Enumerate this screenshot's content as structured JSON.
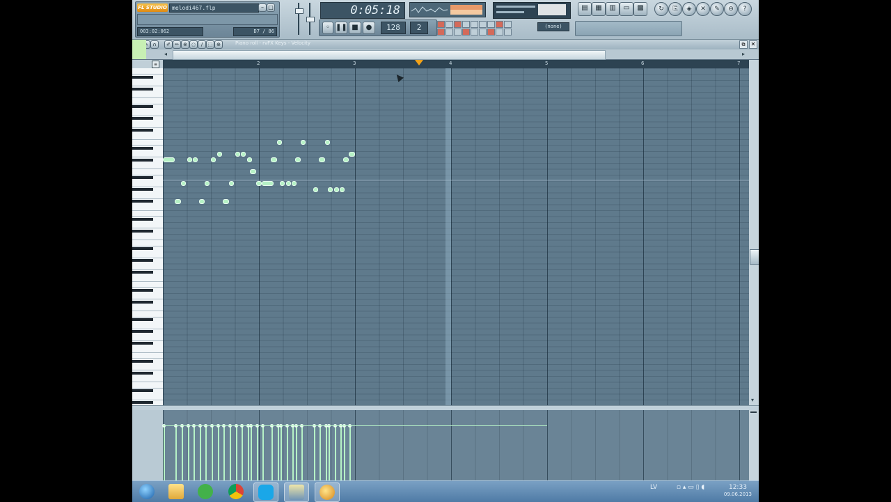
{
  "app": {
    "logo": "FL STUDIO",
    "project_file": "melodi467.flp",
    "position_readout": "003:02:062",
    "steps_readout": "D7 / 86",
    "time_display": "0:05:18",
    "tempo": "128",
    "snap_value": "(none)",
    "pattern_readout": "2"
  },
  "piano_roll": {
    "title": "Piano roll - rvFX Keys - Velocity",
    "bar_numbers": [
      "2",
      "3",
      "4",
      "5",
      "6",
      "7"
    ]
  },
  "notes": [
    {
      "start": 0.0,
      "len": 0.5,
      "row": 15
    },
    {
      "start": 0.5,
      "len": 0.25,
      "row": 22
    },
    {
      "start": 0.75,
      "len": 0.12,
      "row": 19
    },
    {
      "start": 1.0,
      "len": 0.12,
      "row": 15
    },
    {
      "start": 1.25,
      "len": 0.12,
      "row": 15
    },
    {
      "start": 1.5,
      "len": 0.25,
      "row": 22
    },
    {
      "start": 1.75,
      "len": 0.12,
      "row": 19
    },
    {
      "start": 2.0,
      "len": 0.12,
      "row": 15
    },
    {
      "start": 2.25,
      "len": 0.12,
      "row": 14
    },
    {
      "start": 2.5,
      "len": 0.25,
      "row": 22
    },
    {
      "start": 2.75,
      "len": 0.12,
      "row": 19
    },
    {
      "start": 3.0,
      "len": 0.12,
      "row": 14
    },
    {
      "start": 3.25,
      "len": 0.12,
      "row": 14
    },
    {
      "start": 3.5,
      "len": 0.12,
      "row": 15
    },
    {
      "start": 3.62,
      "len": 0.25,
      "row": 17
    },
    {
      "start": 3.87,
      "len": 0.25,
      "row": 19
    },
    {
      "start": 4.12,
      "len": 0.5,
      "row": 19
    },
    {
      "start": 4.5,
      "len": 0.25,
      "row": 15
    },
    {
      "start": 4.75,
      "len": 0.12,
      "row": 12
    },
    {
      "start": 4.87,
      "len": 0.12,
      "row": 19
    },
    {
      "start": 5.12,
      "len": 0.12,
      "row": 19
    },
    {
      "start": 5.37,
      "len": 0.12,
      "row": 19
    },
    {
      "start": 5.5,
      "len": 0.25,
      "row": 15
    },
    {
      "start": 5.75,
      "len": 0.12,
      "row": 12
    },
    {
      "start": 6.25,
      "len": 0.12,
      "row": 20
    },
    {
      "start": 6.5,
      "len": 0.25,
      "row": 15
    },
    {
      "start": 6.75,
      "len": 0.12,
      "row": 12
    },
    {
      "start": 6.87,
      "len": 0.12,
      "row": 20
    },
    {
      "start": 7.12,
      "len": 0.12,
      "row": 20
    },
    {
      "start": 7.37,
      "len": 0.12,
      "row": 20
    },
    {
      "start": 7.5,
      "len": 0.25,
      "row": 15
    },
    {
      "start": 7.75,
      "len": 0.25,
      "row": 14
    }
  ],
  "taskbar": {
    "items": [
      "start-orb",
      "explorer",
      "utorrent",
      "chrome",
      "skype",
      "app",
      "fl-studio"
    ],
    "language": "LV",
    "clock": "12:33",
    "date": "09.06.2013"
  }
}
